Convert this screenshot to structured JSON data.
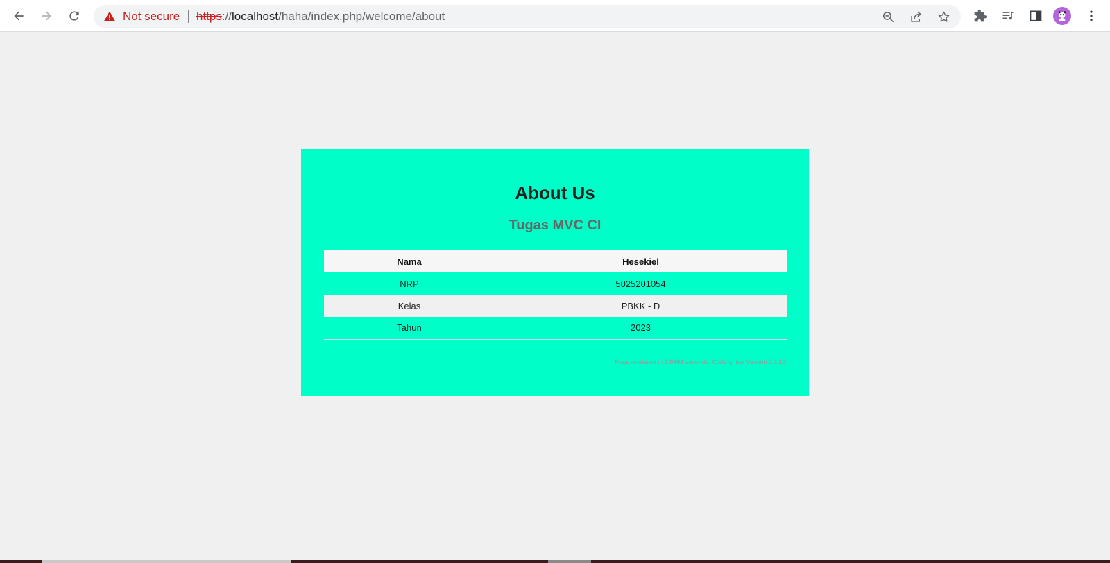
{
  "browser": {
    "security_label": "Not secure",
    "url_scheme": "https",
    "url_sep": "://",
    "url_host": "localhost",
    "url_path": "/haha/index.php/welcome/about",
    "icons": {
      "back": "arrow-left-icon",
      "forward": "arrow-right-icon",
      "reload": "reload-icon",
      "warning": "warning-triangle-icon",
      "zoom": "zoom-out-icon",
      "share": "share-icon",
      "bookmark": "star-icon",
      "extensions": "puzzle-icon",
      "media": "media-queue-icon",
      "side_panel": "side-panel-icon",
      "profile": "avatar",
      "menu": "kebab-menu-icon"
    },
    "colors": {
      "warning": "#c5221f",
      "omnibox_bg": "#f1f3f4"
    }
  },
  "page": {
    "background": "#f0f0f0",
    "card_color": "#00ffc8",
    "title": "About Us",
    "subtitle": "Tugas MVC CI",
    "table": {
      "header": [
        "Nama",
        "Hesekiel"
      ],
      "rows": [
        [
          "NRP",
          "5025201054"
        ],
        [
          "Kelas",
          "PBKK - D"
        ],
        [
          "Tahun",
          "2023"
        ]
      ]
    },
    "footer": {
      "prefix": "Page rendered in",
      "time": "0.0402",
      "suffix": "seconds. CodeIgniter Version 3.1.13"
    }
  }
}
